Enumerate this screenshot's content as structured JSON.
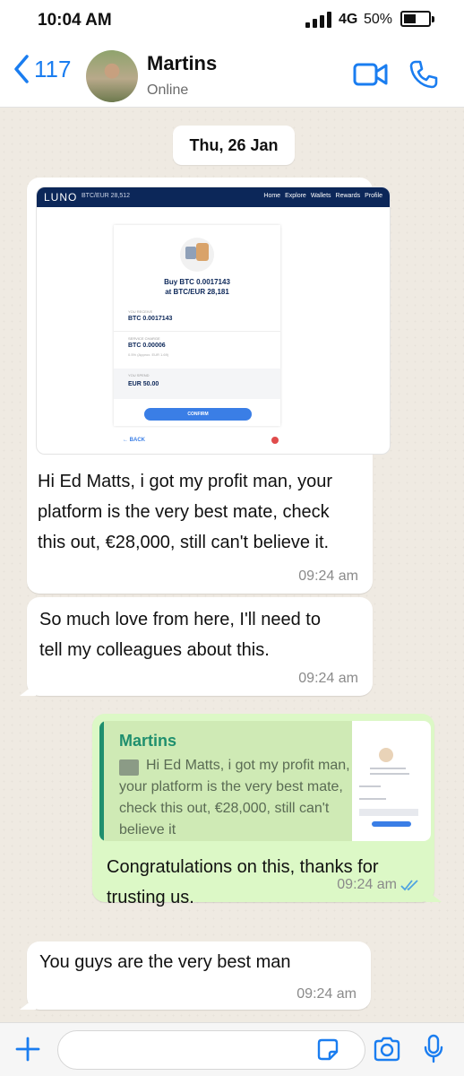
{
  "status_bar": {
    "time": "10:04 AM",
    "network": "4G",
    "battery": "50%",
    "battery_level": 0.5,
    "signal_bars": 4
  },
  "header": {
    "back_count": "117",
    "contact_name": "Martins",
    "contact_status": "Online",
    "icons": [
      "back-chevron-icon",
      "video-call-icon",
      "phone-icon"
    ]
  },
  "date_chip": "Thu, 26 Jan",
  "messages": [
    {
      "direction": "incoming",
      "has_image": true,
      "text": "Hi Ed Matts, i got my profit man, your platform is the very best mate, check this out, €28,000, still can't believe it.",
      "lines": [
        "Hi Ed Matts, i got my profit man, your",
        "platform is the very best mate, check",
        "this out, €28,000, still can't believe it."
      ],
      "time": "09:24 am"
    },
    {
      "direction": "incoming",
      "text": "So much love from here, I'll need to tell my colleagues about this.",
      "lines": [
        "So much love from here, I'll need to",
        "tell my colleagues about this."
      ],
      "time": "09:24 am"
    },
    {
      "direction": "outgoing",
      "quote": {
        "name": "Martins",
        "text": "Hi Ed Matts, i got my profit man, your platform is the very best mate, check this out, €28,000, still can't believe it"
      },
      "text": "Congratulations on this, thanks for trusting us.",
      "lines": [
        "Congratulations on this, thanks for",
        "trusting us."
      ],
      "time": "09:24 am",
      "read": true
    },
    {
      "direction": "incoming",
      "text": "You guys are the very best man",
      "lines": [
        "You guys are the very best man"
      ],
      "time": "09:24 am"
    }
  ],
  "shared_image": {
    "logo": "LUNO",
    "price": "BTC/EUR 28,512",
    "menu": [
      "Home",
      "Explore",
      "Wallets",
      "Rewards",
      "Profile"
    ],
    "title_line1": "Buy BTC 0.0017143",
    "title_line2": "at BTC/EUR 28,181",
    "you_receive_label": "YOU RECEIVE",
    "you_receive_value": "BTC 0.0017143",
    "service_charge_label": "SERVICE CHARGE",
    "service_charge_value": "BTC 0.00006",
    "service_charge_sub": "0.5% (Approx. EUR 1.69)",
    "you_spend_label": "YOU SPEND",
    "you_spend_value": "EUR 50.00",
    "confirm_label": "CONFIRM",
    "back_label": "← BACK"
  },
  "input_bar": {
    "placeholder": "",
    "icons": [
      "plus-icon",
      "sticker-icon",
      "camera-icon",
      "microphone-icon"
    ]
  }
}
